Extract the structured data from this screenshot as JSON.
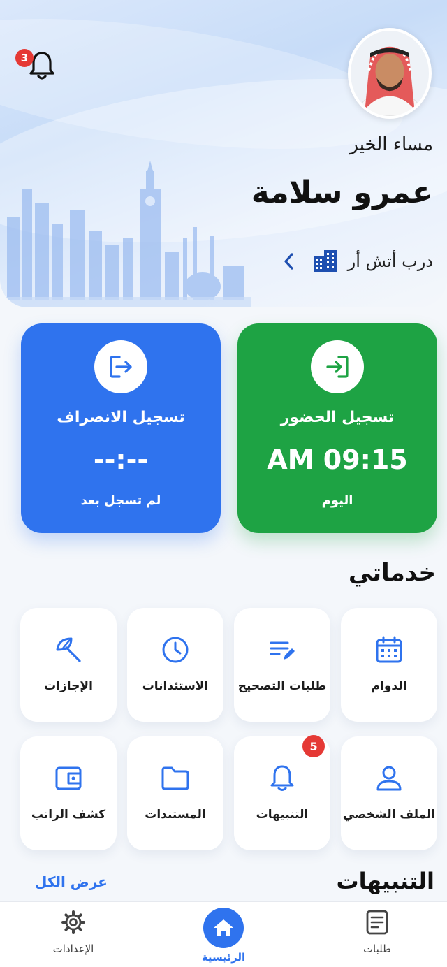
{
  "header": {
    "notification_count": "3",
    "greeting": "مساء الخير",
    "user_name": "عمرو سلامة",
    "company": "درب أتش أر"
  },
  "attendance": {
    "check_in": {
      "title": "تسجيل الحضور",
      "time": "AM 09:15",
      "status": "اليوم"
    },
    "check_out": {
      "title": "تسجيل الانصراف",
      "time": "--:--",
      "status": "لم تسجل بعد"
    }
  },
  "services": {
    "title": "خدماتي",
    "items": [
      {
        "label": "الدوام",
        "icon": "calendar-icon"
      },
      {
        "label": "طلبات التصحيح",
        "icon": "edit-list-icon"
      },
      {
        "label": "الاستئذانات",
        "icon": "clock-icon"
      },
      {
        "label": "الإجازات",
        "icon": "beach-umbrella-icon"
      },
      {
        "label": "الملف الشخصي",
        "icon": "user-icon"
      },
      {
        "label": "التنبيهات",
        "icon": "bell-icon",
        "badge": "5"
      },
      {
        "label": "المستندات",
        "icon": "folder-icon"
      },
      {
        "label": "كشف الراتب",
        "icon": "wallet-icon"
      }
    ]
  },
  "alerts": {
    "title": "التنبيهات",
    "view_all": "عرض الكل"
  },
  "nav": {
    "requests": "طلبات",
    "home": "الرئيسية",
    "settings": "الإعدادات"
  },
  "colors": {
    "primary_blue": "#2f73ee",
    "check_in_green": "#1ea344",
    "badge_red": "#e53935"
  }
}
